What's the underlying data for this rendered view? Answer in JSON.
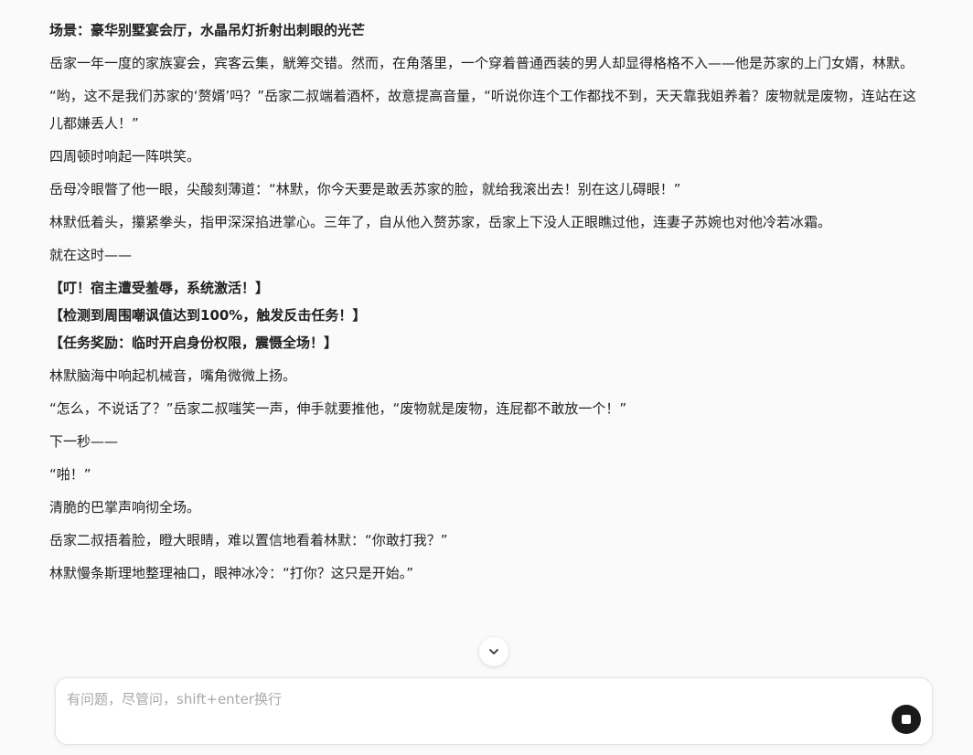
{
  "story": {
    "title": "场景：豪华别墅宴会厅，水晶吊灯折射出刺眼的光芒",
    "paragraphs": [
      "岳家一年一度的家族宴会，宾客云集，觥筹交错。然而，在角落里，一个穿着普通西装的男人却显得格格不入——他是苏家的上门女婿，林默。",
      "“哟，这不是我们苏家的‘赘婿’吗？”岳家二叔端着酒杯，故意提高音量，“听说你连个工作都找不到，天天靠我姐养着？废物就是废物，连站在这儿都嫌丢人！”",
      "四周顿时响起一阵哄笑。",
      "岳母冷眼瞥了他一眼，尖酸刻薄道：“林默，你今天要是敢丢苏家的脸，就给我滚出去！别在这儿碍眼！”",
      "林默低着头，攥紧拳头，指甲深深掐进掌心。三年了，自从他入赘苏家，岳家上下没人正眼瞧过他，连妻子苏婉也对他冷若冰霜。",
      "就在这时——"
    ],
    "system_lines": [
      "【叮！宿主遭受羞辱，系统激活！】",
      "【检测到周围嘲讽值达到100%，触发反击任务！】",
      "【任务奖励：临时开启身份权限，震慑全场！】"
    ],
    "paragraphs_after": [
      "林默脑海中响起机械音，嘴角微微上扬。",
      "“怎么，不说话了？”岳家二叔嗤笑一声，伸手就要推他，“废物就是废物，连屁都不敢放一个！”",
      "下一秒——",
      "“啪！”",
      "清脆的巴掌声响彻全场。",
      "岳家二叔捂着脸，瞪大眼睛，难以置信地看着林默：“你敢打我？”",
      "林默慢条斯理地整理袖口，眼神冰冷：“打你？这只是开始。”"
    ]
  },
  "input": {
    "placeholder": "有问题，尽管问，shift+enter换行",
    "value": ""
  },
  "icons": {
    "scroll_down": "chevron-down-icon",
    "stop": "stop-icon"
  },
  "colors": {
    "background": "#fafafa",
    "stop_button": "#1a1a1a",
    "placeholder": "#a8a8a8"
  }
}
